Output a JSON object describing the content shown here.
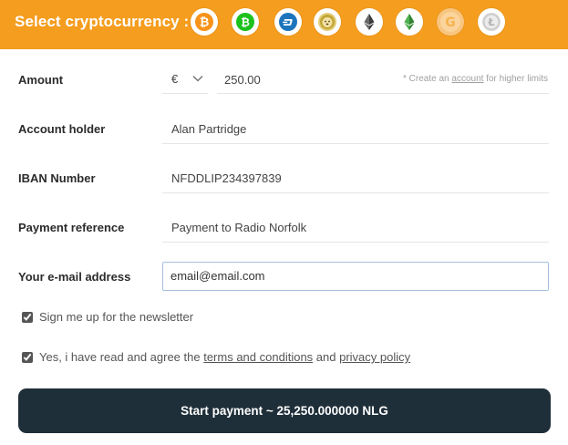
{
  "header": {
    "title": "Select cryptocurrency :",
    "coins": [
      {
        "name": "bitcoin-icon",
        "color": "#f7931a"
      },
      {
        "name": "bitcoin-cash-icon",
        "color": "#1dc11d"
      },
      {
        "name": "dash-icon",
        "color": "#1c75bc"
      },
      {
        "name": "dogecoin-icon",
        "color": "#c2a633"
      },
      {
        "name": "ethereum-icon",
        "color": "#3c3c3d"
      },
      {
        "name": "ethereum-classic-icon",
        "color": "#328332"
      },
      {
        "name": "gulden-icon",
        "color": "#f5a623"
      },
      {
        "name": "litecoin-icon",
        "color": "#bebebe"
      }
    ],
    "accent": "#f59d1e"
  },
  "form": {
    "amount": {
      "label": "Amount",
      "currency": "€",
      "value": "250.00",
      "hint_prefix": "* Create an ",
      "hint_link": "account",
      "hint_suffix": " for higher limits"
    },
    "account_holder": {
      "label": "Account holder",
      "value": "Alan Partridge"
    },
    "iban": {
      "label": "IBAN Number",
      "value": "NFDDLIP234397839"
    },
    "reference": {
      "label": "Payment reference",
      "value": "Payment to Radio Norfolk"
    },
    "email": {
      "label": "Your e-mail address",
      "value": "email@email.com"
    },
    "newsletter": {
      "label": "Sign me up for the newsletter",
      "checked": true
    },
    "agree": {
      "prefix": "Yes, i have read and agree the ",
      "terms": "terms and conditions",
      "middle": " and ",
      "privacy": "privacy policy",
      "checked": true
    }
  },
  "submit": {
    "label": "Start payment ~ 25,250.000000 NLG",
    "color": "#1f2f3a"
  }
}
